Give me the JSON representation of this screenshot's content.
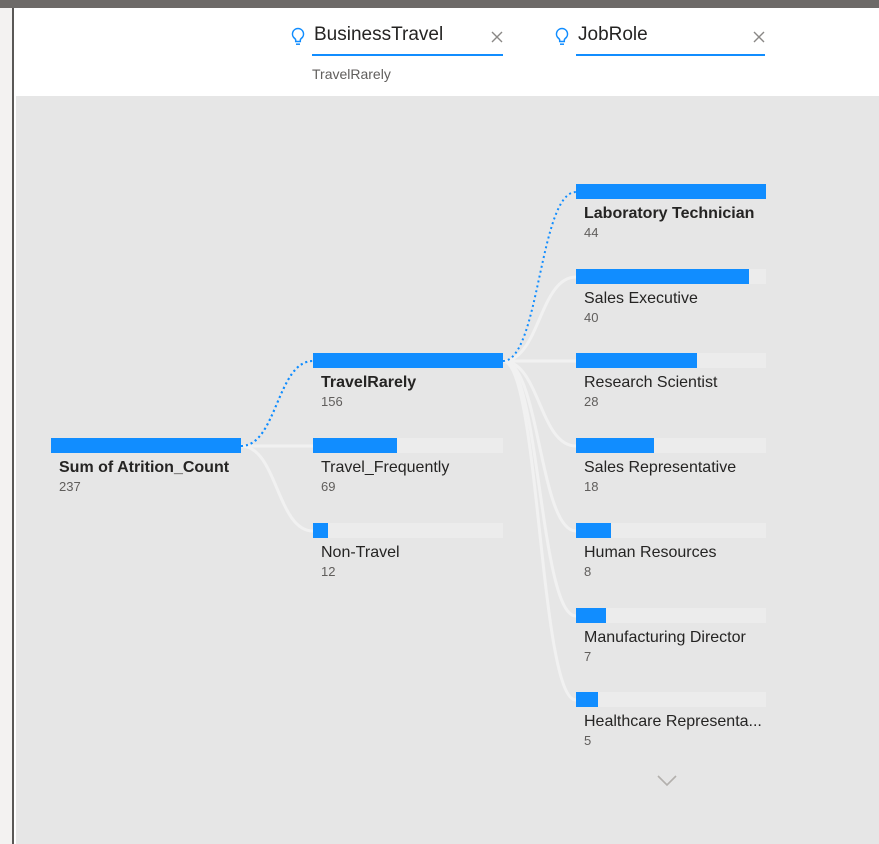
{
  "header": {
    "levels": [
      {
        "title": "BusinessTravel",
        "selection": "TravelRarely"
      },
      {
        "title": "JobRole",
        "selection": ""
      }
    ]
  },
  "tree": {
    "root": {
      "label": "Sum of Atrition_Count",
      "value": 237,
      "max": 237
    },
    "business_travel": [
      {
        "label": "TravelRarely",
        "value": 156,
        "selected": true
      },
      {
        "label": "Travel_Frequently",
        "value": 69,
        "selected": false
      },
      {
        "label": "Non-Travel",
        "value": 12,
        "selected": false
      }
    ],
    "job_role": [
      {
        "label": "Laboratory Technician",
        "value": 44,
        "selected": true
      },
      {
        "label": "Sales Executive",
        "value": 40,
        "selected": false
      },
      {
        "label": "Research Scientist",
        "value": 28,
        "selected": false
      },
      {
        "label": "Sales Representative",
        "value": 18,
        "selected": false
      },
      {
        "label": "Human Resources",
        "value": 8,
        "selected": false
      },
      {
        "label": "Manufacturing Director",
        "value": 7,
        "selected": false
      },
      {
        "label": "Healthcare Representa...",
        "value": 5,
        "selected": false
      }
    ]
  },
  "colors": {
    "accent": "#118dff",
    "canvas": "#e6e6e6",
    "track": "#ececec"
  },
  "icons": {
    "level_icon": "lightbulb-icon",
    "close_icon": "close-icon",
    "more_icon": "chevron-down-icon"
  }
}
